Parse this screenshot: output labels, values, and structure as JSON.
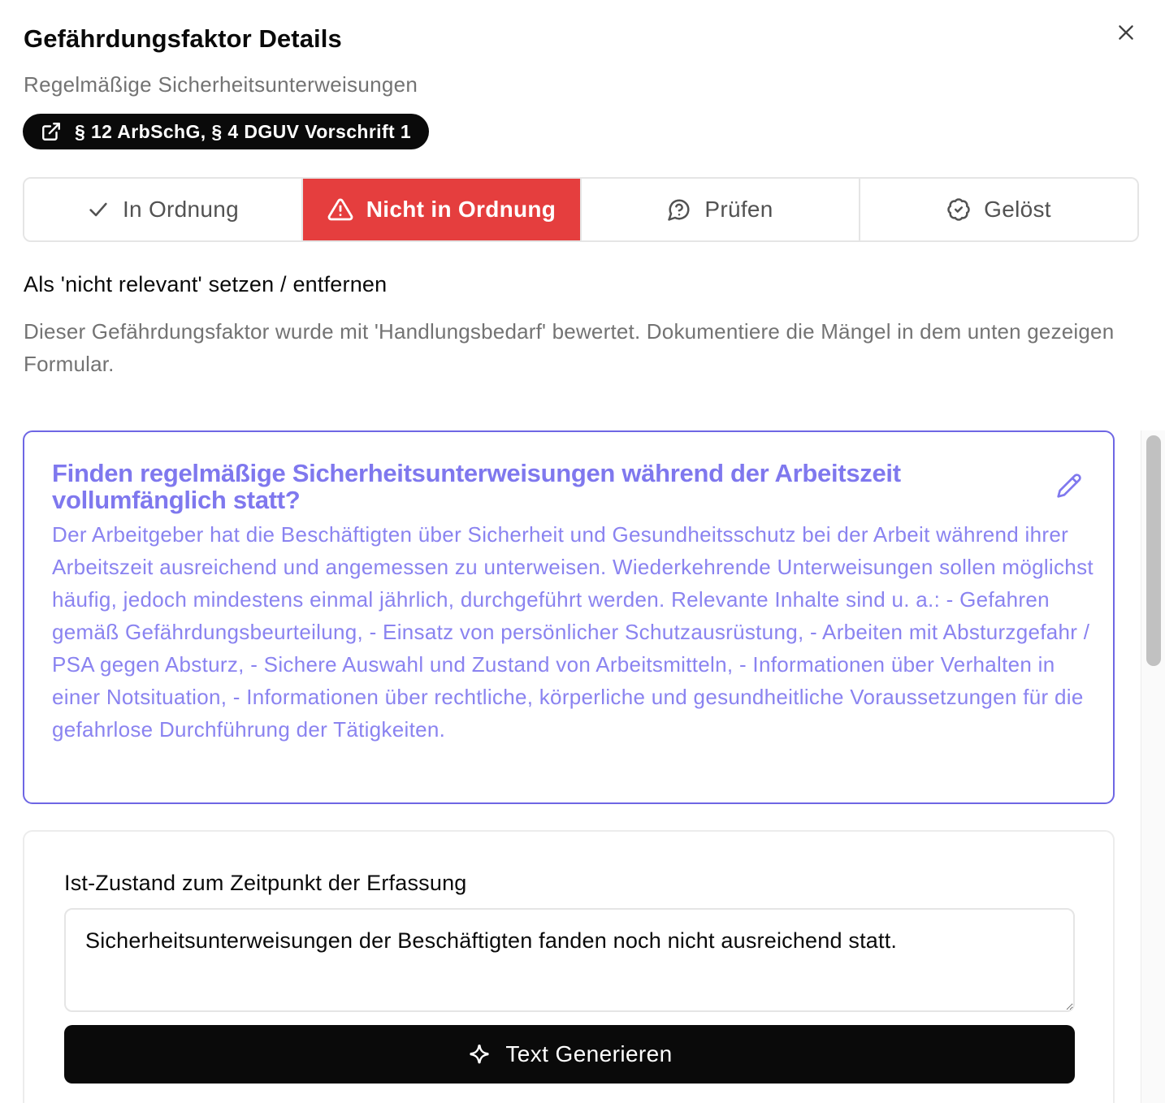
{
  "dialog": {
    "title": "Gefährdungsfaktor Details",
    "subtitle": "Regelmäßige Sicherheitsunterweisungen",
    "law_reference": "§ 12 ArbSchG, § 4 DGUV Vorschrift 1",
    "close_icon": "close-icon"
  },
  "status": {
    "options": [
      {
        "label": "In Ordnung",
        "icon": "check-icon",
        "active": false
      },
      {
        "label": "Nicht in Ordnung",
        "icon": "alert-triangle-icon",
        "active": true
      },
      {
        "label": "Prüfen",
        "icon": "message-question-icon",
        "active": false
      },
      {
        "label": "Gelöst",
        "icon": "badge-check-icon",
        "active": false
      }
    ],
    "active_color": "#e53e3e"
  },
  "relevance": {
    "toggle_label": "Als 'nicht relevant' setzen / entfernen",
    "notice": "Dieser Gefährdungsfaktor wurde mit 'Handlungsbedarf' bewertet. Dokumentiere die Mängel in dem unten gezeigen Formular."
  },
  "question": {
    "title": "Finden regelmäßige Sicherheitsunterweisungen während der Arbeitszeit vollumfänglich statt?",
    "description": "Der Arbeitgeber hat die Beschäftigten über Sicherheit und Gesundheitsschutz bei der Arbeit während ihrer Arbeitszeit ausreichend und angemessen zu unterweisen. Wiederkehrende Unterweisungen sollen möglichst häufig, jedoch mindestens einmal jährlich, durchgeführt werden. Relevante Inhalte sind u. a.: - Gefahren gemäß Gefährdungsbeurteilung, - Einsatz von persönlicher Schutzausrüstung, - Arbeiten mit Absturzgefahr / PSA gegen Absturz, - Sichere Auswahl und Zustand von Arbeitsmitteln, - Informationen über Verhalten in einer Notsituation, - Informationen über rechtliche, körperliche und gesundheitliche Voraussetzungen für die gefahrlose Durchführung der Tätigkeiten.",
    "accent_color": "#7f78ee",
    "edit_icon": "pencil-icon"
  },
  "form": {
    "label": "Ist-Zustand zum Zeitpunkt der Erfassung",
    "value": "Sicherheitsunterweisungen der Beschäftigten fanden noch nicht ausreichend statt.",
    "generate_label": "Text Generieren",
    "generate_icon": "sparkle-icon"
  }
}
